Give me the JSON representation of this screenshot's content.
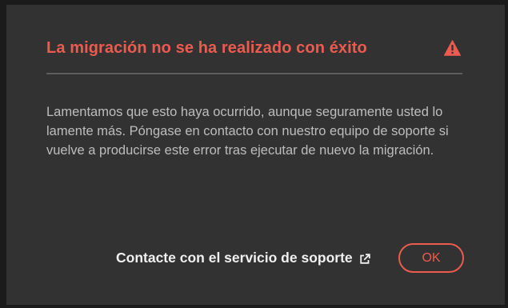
{
  "dialog": {
    "title": "La migración no se ha realizado con éxito",
    "message": "Lamentamos que esto haya ocurrido, aunque seguramente usted lo lamente más. Póngase en contacto con nuestro equipo de soporte si vuelve a producirse este error tras ejecutar de nuevo la migración.",
    "support_link_label": "Contacte con el servicio de soporte",
    "ok_label": "OK",
    "title_icon": "warning-triangle-icon",
    "link_icon": "external-link-icon"
  },
  "colors": {
    "error": "#ec5b50",
    "dialog_background": "#323232",
    "body_text": "#bdbdbd",
    "link_text": "#f0f0f0"
  }
}
